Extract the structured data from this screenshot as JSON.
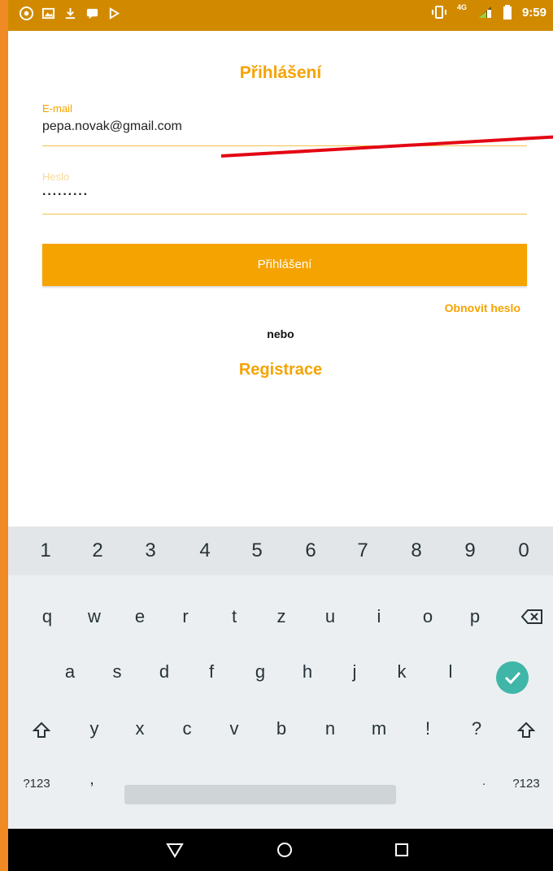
{
  "status_bar": {
    "time": "9:59",
    "network": "4G",
    "left_icons": [
      "gmail-icon",
      "image-icon",
      "download-icon",
      "chat-icon",
      "play-icon"
    ]
  },
  "login": {
    "title": "Přihlášení",
    "email_label": "E-mail",
    "email_value": "pepa.novak@gmail.com",
    "password_label": "Heslo",
    "password_value": "·········",
    "login_button": "Přihlášení",
    "reset_link": "Obnovit heslo",
    "or_label": "nebo",
    "register_link": "Registrace"
  },
  "keyboard": {
    "numbers": [
      "1",
      "2",
      "3",
      "4",
      "5",
      "6",
      "7",
      "8",
      "9",
      "0"
    ],
    "row2": [
      "q",
      "w",
      "e",
      "r",
      "t",
      "z",
      "u",
      "i",
      "o",
      "p"
    ],
    "row3": [
      "a",
      "s",
      "d",
      "f",
      "g",
      "h",
      "j",
      "k",
      "l"
    ],
    "row4": [
      "y",
      "x",
      "c",
      "v",
      "b",
      "n",
      "m",
      "!",
      "?"
    ],
    "symbols_left": "?123",
    "comma": ",",
    "period": "·",
    "symbols_right": "?123"
  },
  "colors": {
    "accent": "#f5a300",
    "status_bar": "#d18a00",
    "enter_key": "#3fb6a8",
    "annotation": "#e30613"
  }
}
